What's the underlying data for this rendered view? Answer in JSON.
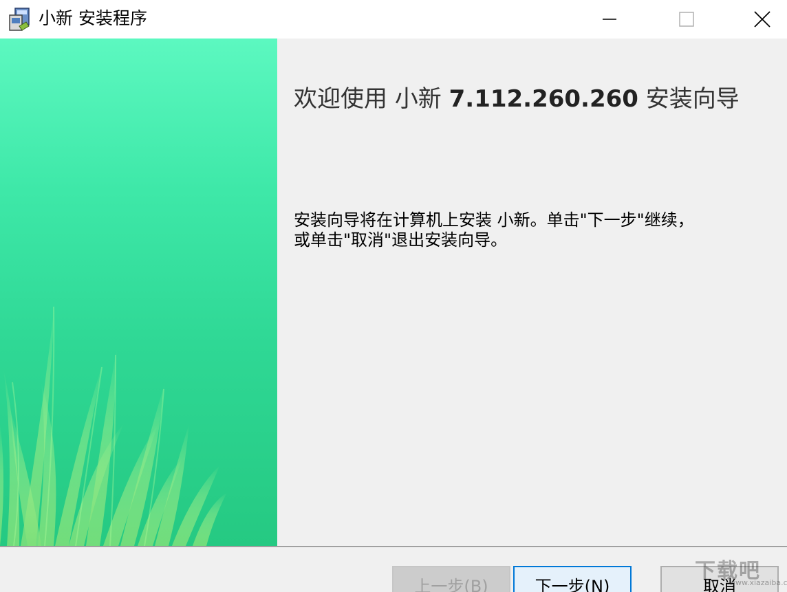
{
  "window": {
    "title": "小新 安装程序",
    "controls": {
      "minimize_icon": "minimize-icon",
      "maximize_icon": "maximize-icon",
      "close_icon": "close-icon"
    }
  },
  "banner": {
    "background_top": "#5cf8c0",
    "background_bottom": "#25c982",
    "grass_color": "#8fe87a"
  },
  "content": {
    "heading_prefix": "欢迎使用 小新 ",
    "heading_version": "7.112.260.260",
    "heading_suffix": " 安装向导",
    "description_line1": "安装向导将在计算机上安装 小新。单击\"下一步\"继续，",
    "description_line2": "或单击\"取消\"退出安装向导。"
  },
  "footer": {
    "back_label": "上一步(B)",
    "next_label": "下一步(N)",
    "cancel_label": "取消",
    "back_disabled": true
  },
  "watermark": {
    "text": "下载吧",
    "sub": "www.xiazaiba.com"
  }
}
